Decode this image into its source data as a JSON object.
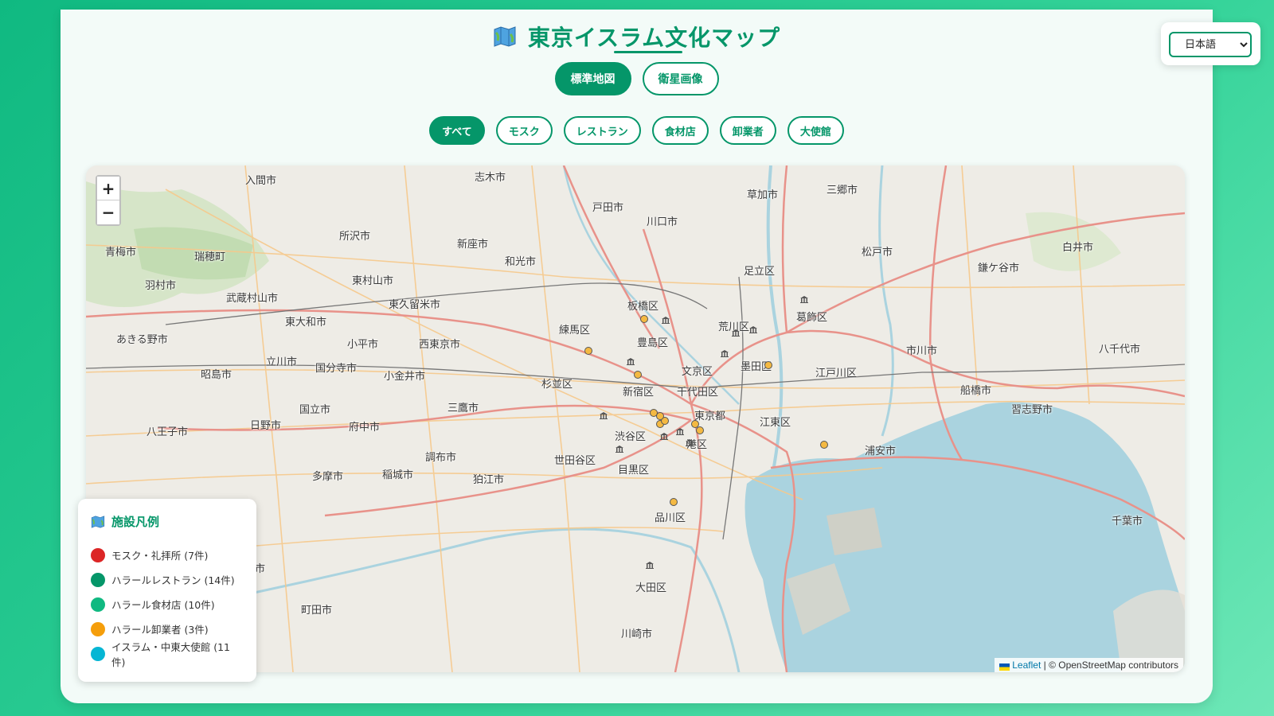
{
  "header": {
    "title": "東京イスラム文化マップ",
    "title_icon": "map-icon"
  },
  "view_toggle": [
    {
      "label": "標準地図",
      "active": true
    },
    {
      "label": "衛星画像",
      "active": false
    }
  ],
  "filters": [
    {
      "label": "すべて",
      "active": true
    },
    {
      "label": "モスク",
      "active": false
    },
    {
      "label": "レストラン",
      "active": false
    },
    {
      "label": "食材店",
      "active": false
    },
    {
      "label": "卸業者",
      "active": false
    },
    {
      "label": "大使館",
      "active": false
    }
  ],
  "language": {
    "selected": "日本語"
  },
  "map": {
    "zoom_in": "+",
    "zoom_out": "−",
    "attribution": {
      "leaflet": "Leaflet",
      "rest": "| © OpenStreetMap contributors"
    },
    "places": [
      "入間市",
      "志木市",
      "戸田市",
      "草加市",
      "三郷市",
      "所沢市",
      "新座市",
      "和光市",
      "川口市",
      "青梅市",
      "瑞穂町",
      "東村山市",
      "足立区",
      "松戸市",
      "白井市",
      "鎌ケ谷市",
      "羽村市",
      "武蔵村山市",
      "東久留米市",
      "板橋区",
      "葛飾区",
      "東大和市",
      "練馬区",
      "荒川区",
      "あきる野市",
      "小平市",
      "西東京市",
      "豊島区",
      "市川市",
      "八千代市",
      "立川市",
      "国分寺市",
      "文京区",
      "墨田区",
      "江戸川区",
      "昭島市",
      "小金井市",
      "杉並区",
      "新宿区",
      "千代田区",
      "船橋市",
      "国立市",
      "三鷹市",
      "東京都",
      "習志野市",
      "日野市",
      "府中市",
      "江東区",
      "八王子市",
      "渋谷区",
      "港区",
      "浦安市",
      "調布市",
      "世田谷区",
      "目黒区",
      "多摩市",
      "稲城市",
      "狛江市",
      "品川区",
      "千葉市",
      "大田区",
      "町田市",
      "川崎市",
      "市"
    ],
    "colors": {
      "water": "#aad3df",
      "land": "#eeece6",
      "motorway": "#e8928a",
      "primary": "#f6c98c"
    }
  },
  "legend": {
    "title": "施設凡例",
    "icon": "map-icon",
    "items": [
      {
        "label": "モスク・礼拝所 (7件)",
        "color": "#dc2626"
      },
      {
        "label": "ハラールレストラン (14件)",
        "color": "#059669"
      },
      {
        "label": "ハラール食材店 (10件)",
        "color": "#10b981"
      },
      {
        "label": "ハラール卸業者 (3件)",
        "color": "#f59e0b"
      },
      {
        "label": "イスラム・中東大使館 (11件)",
        "color": "#06b6d4"
      }
    ]
  }
}
